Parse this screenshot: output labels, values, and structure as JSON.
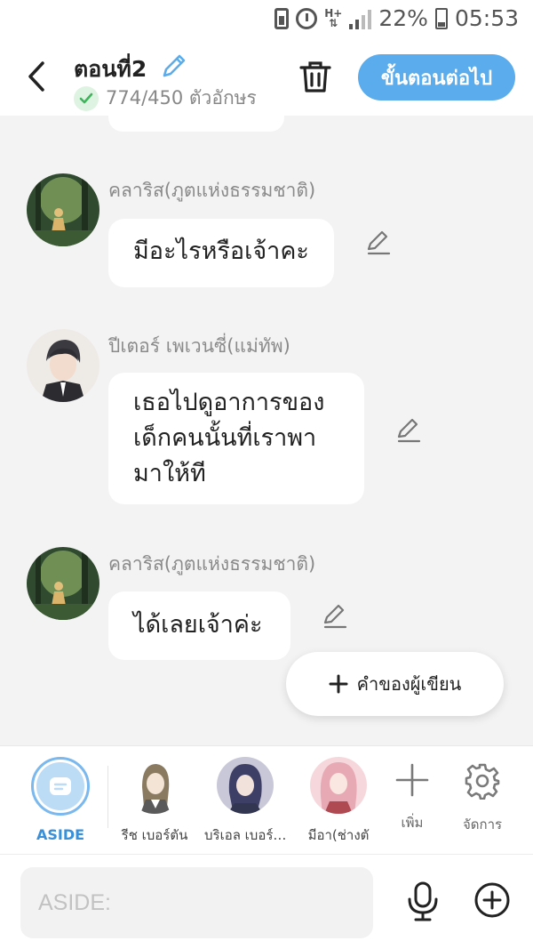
{
  "status_bar": {
    "battery_percent": "22%",
    "time": "05:53",
    "network": "H+",
    "icons": [
      "battery-saver-icon",
      "alarm-icon",
      "network-type-icon",
      "signal-icon",
      "battery-icon"
    ]
  },
  "header": {
    "title": "ตอนที่2",
    "char_count": "774/450 ตัวอักษร",
    "next_button": "ขั้นตอนต่อไป",
    "accent_color": "#5aacec"
  },
  "messages": [
    {
      "speaker": "คลาริส(ภูตแห่งธรรมชาติ)",
      "lines": [
        "มีอะไรหรือเจ้าคะ"
      ],
      "avatar": "forest-girl"
    },
    {
      "speaker": "ปีเตอร์ เพเวนซี่(แม่ทัพ)",
      "lines": [
        "เธอไปดูอาการของ",
        "เด็กคนนั้นที่เราพา",
        "มาให้ที"
      ],
      "avatar": "dark-hair-man"
    },
    {
      "speaker": "คลาริส(ภูตแห่งธรรมชาติ)",
      "lines": [
        "ได้เลยเจ้าค่ะ"
      ],
      "avatar": "forest-girl"
    }
  ],
  "writer_button": "คำของผู้เขียน",
  "character_bar": {
    "aside_label": "ASIDE",
    "characters": [
      {
        "label": "รีช เบอร์ตัน"
      },
      {
        "label": "บริเอล เบอร์…"
      },
      {
        "label": "มีอา(ช่างตั"
      }
    ],
    "add_label": "เพิ่ม",
    "manage_label": "จัดการ"
  },
  "input": {
    "placeholder": "ASIDE:"
  }
}
